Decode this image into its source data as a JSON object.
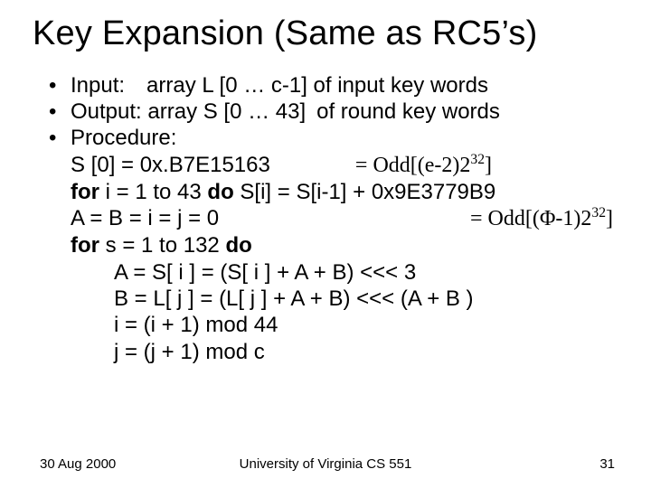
{
  "title": "Key Expansion (Same as RC5’s)",
  "bullets": {
    "input": "Input: array L [0 … c-1] of input key words",
    "output": "Output: array S [0 … 43] of round key words",
    "proc": "Procedure:"
  },
  "lines": {
    "s0": "S [0] = 0x.B7E15163",
    "odd_e": "= Odd[(e-2)2",
    "sup": "32",
    "close": "]",
    "for1a": "for",
    "for1b": "  i = 1 to 43 ",
    "for1c": "do",
    "for1d": " S[i] = S[i-1] + 0x9E3779B9",
    "abij": "A = B = i = j = 0",
    "odd_phi": "= Odd[(Φ-1)2",
    "for2a": "for",
    "for2b": "  s = 1  to  132  ",
    "for2c": "do",
    "a": "A = S[ i ] = (S[ i ] + A + B) <<< 3",
    "b": "B = L[ j ] = (L[ j ] + A + B) <<< (A + B )",
    "i": "i = (i + 1) mod 44",
    "j": "j = (j + 1) mod c"
  },
  "footer": {
    "left": "30 Aug 2000",
    "center": "University of Virginia CS 551",
    "right": "31"
  }
}
